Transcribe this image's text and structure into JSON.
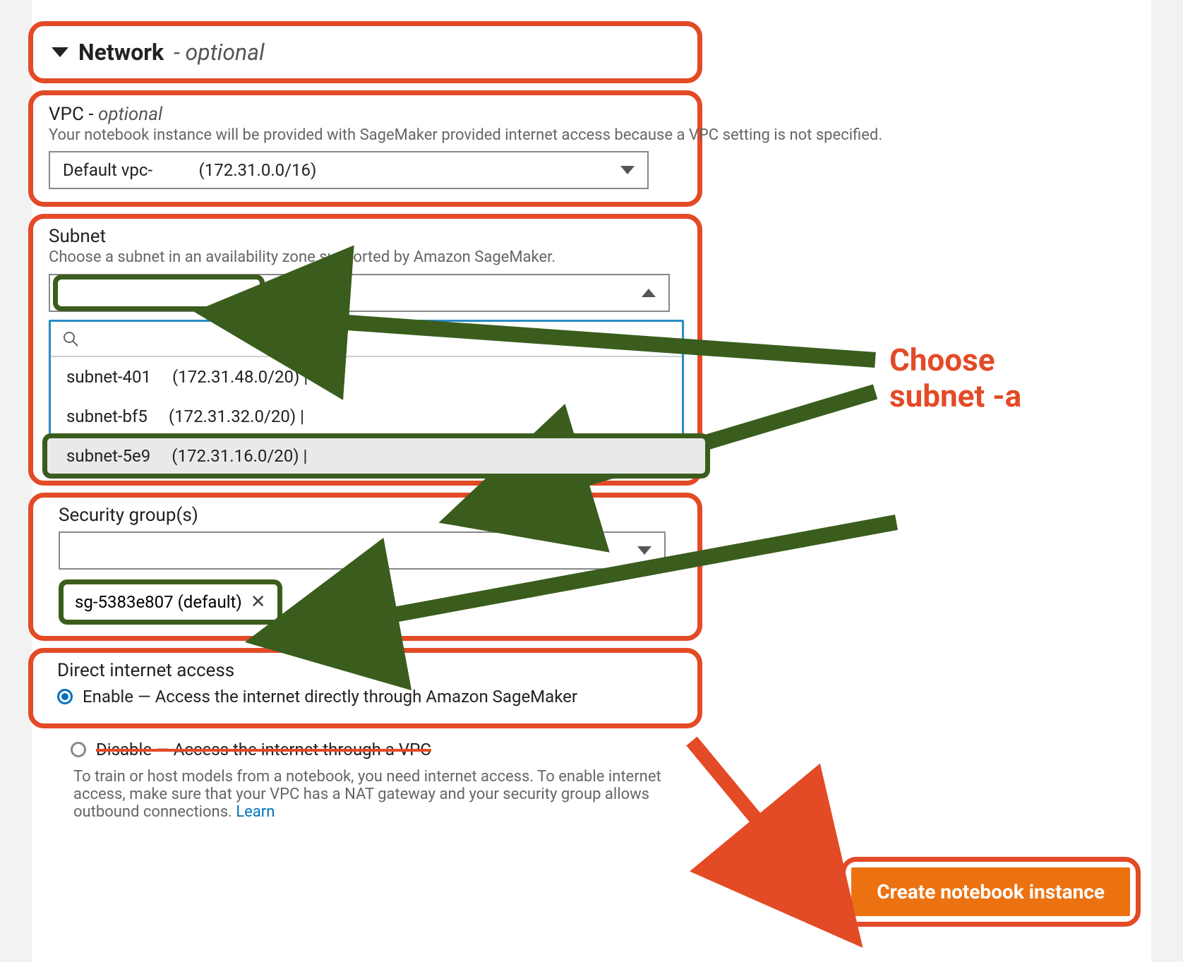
{
  "annotation": {
    "choose_subnet": "Choose\nsubnet -a"
  },
  "section": {
    "title": "Network",
    "optional_suffix": "- optional"
  },
  "vpc": {
    "label": "VPC - ",
    "optional": "optional",
    "help": "Your notebook instance will be provided with SageMaker provided internet access because a VPC setting is not specified.",
    "selected": "Default vpc-           (172.31.0.0/16)"
  },
  "subnet": {
    "label": "Subnet",
    "help": "Choose a subnet in an availability zone supported by Amazon SageMaker.",
    "search_placeholder": "",
    "options": [
      {
        "id": "subnet-401",
        "cidr": "(172.31.48.0/20) |"
      },
      {
        "id": "subnet-bf5",
        "cidr": "(172.31.32.0/20) |"
      },
      {
        "id": "subnet-5e9",
        "cidr": "(172.31.16.0/20) |"
      }
    ]
  },
  "security_group": {
    "label": "Security group(s)",
    "chip": "sg-5383e807 (default)"
  },
  "internet_access": {
    "label": "Direct internet access",
    "enable": "Enable — Access the internet directly through Amazon SageMaker",
    "disable": "Disable — Access the internet through a VPC",
    "disable_help": "To train or host models from a notebook, you need internet access. To enable internet access, make sure that your VPC has a NAT gateway and your security group allows outbound connections.  ",
    "learn": "Learn"
  },
  "cta": {
    "label": "Create notebook instance"
  }
}
